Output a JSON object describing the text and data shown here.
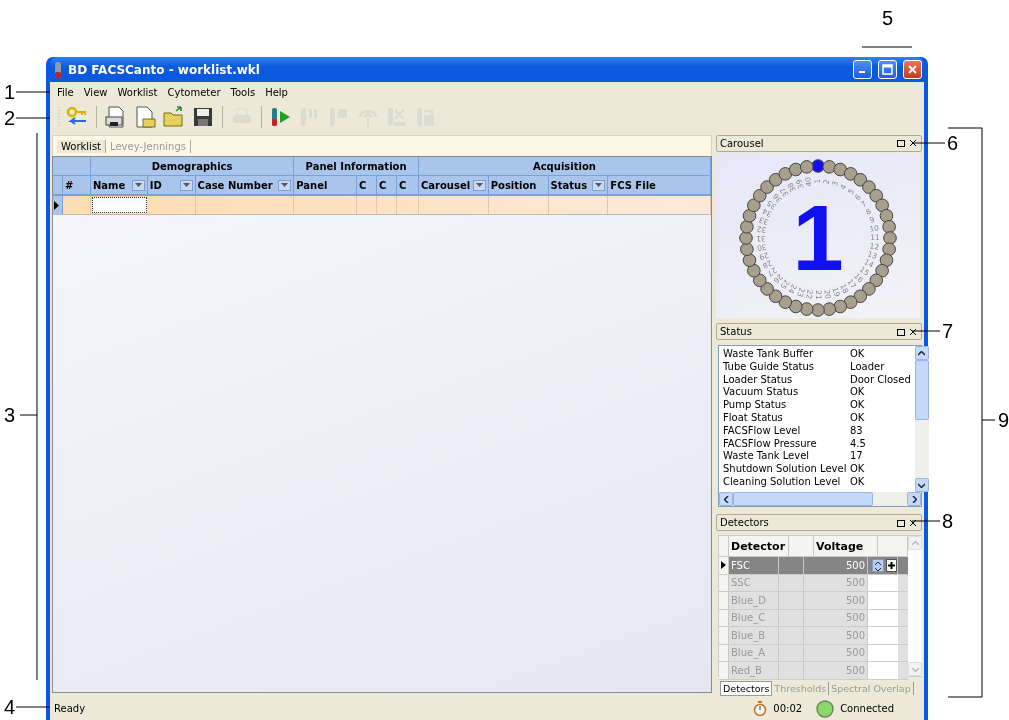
{
  "callouts": [
    {
      "label": "1"
    },
    {
      "label": "2"
    },
    {
      "label": "3"
    },
    {
      "label": "4"
    },
    {
      "label": "5"
    },
    {
      "label": "6"
    },
    {
      "label": "7"
    },
    {
      "label": "8"
    },
    {
      "label": "9"
    }
  ],
  "window": {
    "title": "BD FACSCanto - worklist.wkl"
  },
  "menu": [
    "File",
    "View",
    "Worklist",
    "Cytometer",
    "Tools",
    "Help"
  ],
  "toolbar": [
    {
      "disabled": false
    },
    {
      "disabled": false
    },
    {
      "disabled": false
    },
    {
      "disabled": false
    },
    {
      "disabled": false
    },
    {
      "disabled": true
    },
    {
      "disabled": false
    },
    {
      "disabled": true
    },
    {
      "disabled": true
    },
    {
      "disabled": true
    },
    {
      "disabled": true
    },
    {
      "disabled": true
    }
  ],
  "tabs": [
    {
      "label": "Worklist",
      "selected": true
    },
    {
      "label": "Levey-Jennings",
      "selected": false
    }
  ],
  "table": {
    "leading_columns": [
      {
        "label": "#",
        "filter": false
      }
    ],
    "groups": [
      {
        "label": "Demographics",
        "columns": [
          {
            "label": "Name",
            "filter": true
          },
          {
            "label": "ID",
            "filter": true
          },
          {
            "label": "Case Number",
            "filter": true
          }
        ]
      },
      {
        "label": "Panel Information",
        "columns": [
          {
            "label": "Panel",
            "filter": false
          },
          {
            "label": "C",
            "filter": false
          },
          {
            "label": "C",
            "filter": false
          },
          {
            "label": "C",
            "filter": false
          }
        ]
      },
      {
        "label": "Acquisition",
        "columns": [
          {
            "label": "Carousel",
            "filter": true
          },
          {
            "label": "Position",
            "filter": false
          },
          {
            "label": "Status",
            "filter": true
          },
          {
            "label": "FCS File",
            "filter": false
          }
        ]
      }
    ],
    "rows": [
      {
        "current": true,
        "editing": true
      }
    ]
  },
  "carousel": {
    "title": "Carousel",
    "current": "1",
    "slots": [
      {
        "label": "1",
        "selected": true
      },
      {
        "label": "2",
        "selected": false
      },
      {
        "label": "3",
        "selected": false
      },
      {
        "label": "4",
        "selected": false
      },
      {
        "label": "5",
        "selected": false
      },
      {
        "label": "6",
        "selected": false
      },
      {
        "label": "7",
        "selected": false
      },
      {
        "label": "8",
        "selected": false
      },
      {
        "label": "9",
        "selected": false
      },
      {
        "label": "10",
        "selected": false
      },
      {
        "label": "11",
        "selected": false
      },
      {
        "label": "12",
        "selected": false
      },
      {
        "label": "13",
        "selected": false
      },
      {
        "label": "14",
        "selected": false
      },
      {
        "label": "15",
        "selected": false
      },
      {
        "label": "16",
        "selected": false
      },
      {
        "label": "17",
        "selected": false
      },
      {
        "label": "18",
        "selected": false
      },
      {
        "label": "19",
        "selected": false
      },
      {
        "label": "20",
        "selected": false
      },
      {
        "label": "21",
        "selected": false
      },
      {
        "label": "22",
        "selected": false
      },
      {
        "label": "23",
        "selected": false
      },
      {
        "label": "24",
        "selected": false
      },
      {
        "label": "25",
        "selected": false
      },
      {
        "label": "26",
        "selected": false
      },
      {
        "label": "27",
        "selected": false
      },
      {
        "label": "28",
        "selected": false
      },
      {
        "label": "29",
        "selected": false
      },
      {
        "label": "30",
        "selected": false
      },
      {
        "label": "31",
        "selected": false
      },
      {
        "label": "32",
        "selected": false
      },
      {
        "label": "33",
        "selected": false
      },
      {
        "label": "34",
        "selected": false
      },
      {
        "label": "35",
        "selected": false
      },
      {
        "label": "36",
        "selected": false
      },
      {
        "label": "37",
        "selected": false
      },
      {
        "label": "38",
        "selected": false
      },
      {
        "label": "39",
        "selected": false
      },
      {
        "label": "40",
        "selected": false
      }
    ]
  },
  "status": {
    "title": "Status",
    "items": [
      {
        "name": "Waste Tank Buffer",
        "value": "OK"
      },
      {
        "name": "Tube Guide Status",
        "value": "Loader"
      },
      {
        "name": "Loader Status",
        "value": "Door Closed"
      },
      {
        "name": "Vacuum Status",
        "value": "OK"
      },
      {
        "name": "Pump Status",
        "value": "OK"
      },
      {
        "name": "Float Status",
        "value": "OK"
      },
      {
        "name": "FACSFlow Level",
        "value": "83"
      },
      {
        "name": "FACSFlow Pressure",
        "value": "4.5"
      },
      {
        "name": "Waste Tank Level",
        "value": "17"
      },
      {
        "name": "Shutdown Solution Level",
        "value": "OK"
      },
      {
        "name": "Cleaning Solution Level",
        "value": "OK"
      }
    ]
  },
  "detectors": {
    "title": "Detectors",
    "columns": [
      "Detector",
      "Voltage"
    ],
    "rows": [
      {
        "name": "FSC",
        "voltage": "500",
        "selected": true
      },
      {
        "name": "SSC",
        "voltage": "500",
        "selected": false
      },
      {
        "name": "Blue_D",
        "voltage": "500",
        "selected": false
      },
      {
        "name": "Blue_C",
        "voltage": "500",
        "selected": false
      },
      {
        "name": "Blue_B",
        "voltage": "500",
        "selected": false
      },
      {
        "name": "Blue_A",
        "voltage": "500",
        "selected": false
      },
      {
        "name": "Red_B",
        "voltage": "500",
        "selected": false
      }
    ],
    "tabs": [
      {
        "label": "Detectors",
        "selected": true
      },
      {
        "label": "Thresholds",
        "selected": false
      },
      {
        "label": "Spectral Overlap",
        "selected": false
      }
    ]
  },
  "status_bar": {
    "message": "Ready",
    "timer": "00:02",
    "connection": "Connected",
    "connected": true
  }
}
